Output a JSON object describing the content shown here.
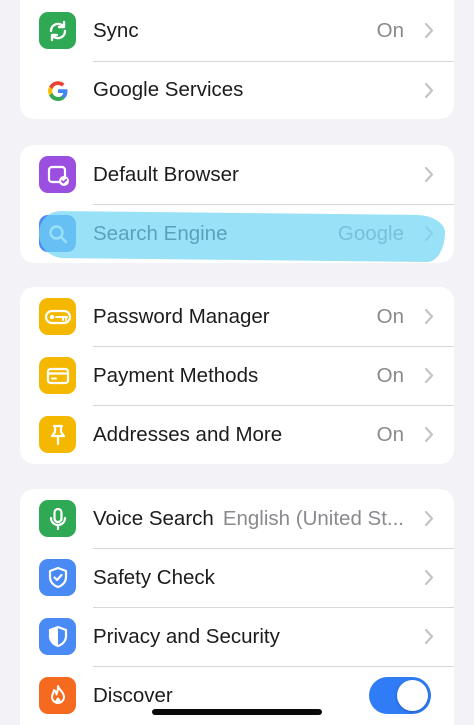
{
  "colors": {
    "background": "#f2f2f7",
    "sync_icon_bg": "#2fa953",
    "browser_icon_bg": "#9b4fe0",
    "search_icon_bg": "#4a8af4",
    "yellow_icon_bg": "#f5b800",
    "voice_icon_bg": "#2fa953",
    "safety_icon_bg": "#4a8af4",
    "privacy_icon_bg": "#4a8af4",
    "discover_icon_bg": "#f56a1e",
    "toggle_on": "#2f7cf6",
    "highlight": "#71d6f4"
  },
  "groups": [
    {
      "rows": [
        {
          "label": "Sync",
          "value": "On",
          "icon": "sync-icon"
        },
        {
          "label": "Google Services",
          "value": "",
          "icon": "google-logo-icon"
        }
      ]
    },
    {
      "rows": [
        {
          "label": "Default Browser",
          "value": "",
          "icon": "default-browser-icon"
        },
        {
          "label": "Search Engine",
          "value": "Google",
          "icon": "search-icon"
        }
      ]
    },
    {
      "rows": [
        {
          "label": "Password Manager",
          "value": "On",
          "icon": "key-icon"
        },
        {
          "label": "Payment Methods",
          "value": "On",
          "icon": "credit-card-icon"
        },
        {
          "label": "Addresses and More",
          "value": "On",
          "icon": "pin-icon"
        }
      ]
    },
    {
      "rows": [
        {
          "label": "Voice Search",
          "value": "English (United St...",
          "icon": "microphone-icon"
        },
        {
          "label": "Safety Check",
          "value": "",
          "icon": "shield-check-icon"
        },
        {
          "label": "Privacy and Security",
          "value": "",
          "icon": "shield-icon"
        },
        {
          "label": "Discover",
          "value": "",
          "icon": "flame-icon",
          "toggle_on": true
        }
      ]
    }
  ]
}
